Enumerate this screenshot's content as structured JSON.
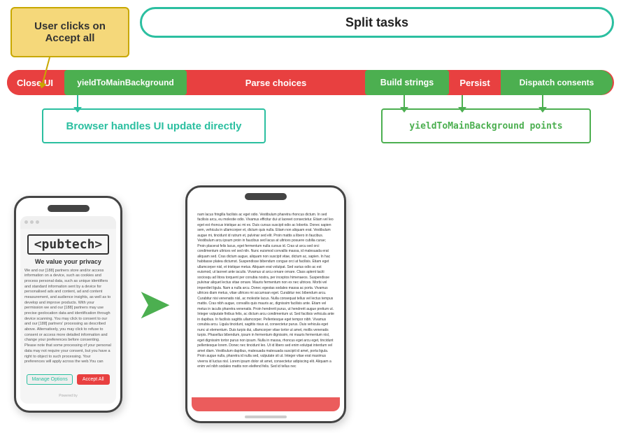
{
  "diagram": {
    "user_clicks_label": "User clicks on\nAccept all",
    "split_tasks_label": "Split tasks",
    "pipeline": {
      "close_ui": "Close UI",
      "yield_main": "yieldToMainBackground",
      "parse_choices": "Parse choices",
      "build_strings": "Build strings",
      "persist": "Persist",
      "dispatch": "Dispatch consents"
    },
    "browser_box": "Browser handles UI update directly",
    "yield_points_box": "yieldToMainBackground  points"
  },
  "phone1": {
    "logo": "<pubtech>",
    "tagline": "We value your privacy",
    "body_text": "We and our [188] partners store and/or access information on a device, such as cookies and process personal data, such as unique identifiers and standard information sent by a device for personalised ads and content, ad and content measurement, and audience insights, as well as to develop and improve products. With your permission we and our [188] partners may use precise geolocation data and identification through device scanning. You may click to consent to our and our [188] partners' processing as described above. Alternatively, you may click to refuse to consent or access more detailed information and change your preferences before consenting. Please note that some processing of your personal data may not require your consent, but you have a right to object to such processing. Your preferences will apply across the web.You can",
    "manage_btn": "Manage Options",
    "accept_btn": "Accept All",
    "powered_by": "Powered by"
  },
  "phone2": {
    "body_text": "nam lacus fringilla facilisis ac eget odio. Vestibulum pharetra rhoncus dictum. In sed facilisis arcu, eu molestie odio. Vivamus efficitur dui ut laoreet consectetur. Etiam vel leo eget est rhoncus tristique ac mi ex. Duis cursus suscipit odio ac lobortis. Donec sapien sem, vehicula in ullamcorper et, dictum quis nulla. Etiam non aliquam erat. Vestibulum augue mi, tincidunt id rutrum et, pulvinar sed elit. Proin mattis a libero in faucibus. Vestibulum arcu ipsum proin in faucibus sed lacus at ultrices posuere cubilia curae; Proin placerat felis lacus, eget fermentum nulla cursus id. Cras ut arcu sed orci condimentum ultrices vel sed niln. Nunc euismod convallis massa, id malesuada erat aliquam sed. Cras dictum augue, aliquam non suscipit vitae, dictum ac, sapien. In hac habitasse platea dictumst. Suspendisse bibendum congue orci at facilisis. Etiam eget ullamcorper nisl, et tristique metus. Aliquam erat volutpat. Sed varius odio ac est euismod, ut laoreet ante iaculis. Vivamus ut arcu ornare ornare. Class aptent taciti sociosqu ad litora torquent per conubia nostra, per inceptos himenaeos. Suspendisse pulvinar aliquet lectus vitae ornare. Mauris fermentum non ex nec ultrices. Morbi vel imperdiet ligula. Nam a nulla arcu. Donec egestas sodales massa ac porta. Vivamus ultrices diam metus, vitae ultrices mi accumsan eget. Curabitur nec bibendum arcu. Curabitur nisi venenatis nisl, ac molestie lacus. Nulla consequat tellus vel lectus tempus mattis. Cras nibh augue, convallis quis mauris ac, dignissim facilisis ante. Etiam vel metus in iaculis pharetra venenatis. Proin hendrerit purus, ut hendrerit augue pretium ut. Integer vulputate finibus felis, ac dictum arcu condimentum ut. Sed facilisis vehicula ante in dapibus. In facilisis sagittis ullamcorper. Pellentesque eget tempor nibh. Vivamus conubia arcu. Ligula tincidunt, sagittis risus ut, consectetur purus. Duis vehicula eget nunc ut elementum. Duis turpis dui, ullamcorper vitae tortor ut amet, mollis venenatis turpis. Phasellus bibendum, ipsum in fermentum dignissim, mi mauris fermentum nisl, eget dignissim tortor purus non ipsum. Nulla in massa, rhoncus eget arcu eget, tincidunt pellentesque lorem. Donec nec tincidunt leo. Ut id libero sed enim volutpat interdum vel amet diam. Vestibulum dapibus, malesuada malesuada suscipit id amet, porta ligula. Proin augue nulla, pharetra id nulla sed, vulputate sit ut. Integer vitae erat maximus viverra id luctus nisl. Lorem ipsum dolor sit amet, consectetur adipiscing elit. Aliquam a enim vel nibh sodales mattis non eleifend felis. Sed id tellus nec"
  },
  "icons": {
    "arrow_right": "➤"
  },
  "colors": {
    "teal": "#2bbfa0",
    "green": "#4caf50",
    "red": "#e84040",
    "gold": "#f5d87a",
    "gold_border": "#c8a800"
  }
}
